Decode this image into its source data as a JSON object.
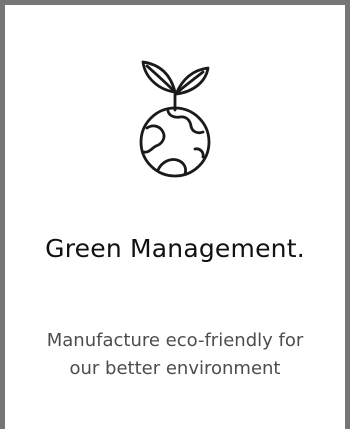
{
  "card": {
    "icon": "leaf-globe-icon",
    "title": "Green Management.",
    "description": "Manufacture eco-friendly for our better environment",
    "colors": {
      "border": "#767676",
      "title": "#111111",
      "description": "#4d4d4d",
      "background": "#ffffff"
    }
  }
}
